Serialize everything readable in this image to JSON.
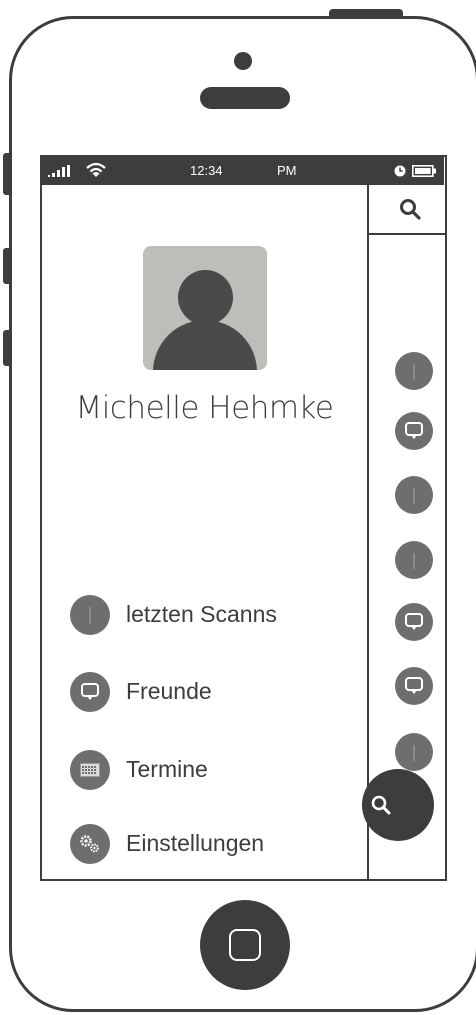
{
  "status_bar": {
    "time": "12:34",
    "ampm": "PM"
  },
  "profile": {
    "name": "Michelle Hehmke"
  },
  "menu": {
    "items": [
      {
        "label": "letzten Scanns",
        "icon": "info-icon"
      },
      {
        "label": "Freunde",
        "icon": "chat-bubble-icon"
      },
      {
        "label": "Termine",
        "icon": "calendar-icon"
      },
      {
        "label": "Einstellungen",
        "icon": "gears-icon"
      }
    ]
  },
  "rail": {
    "icons": [
      "info-icon",
      "chat-bubble-icon",
      "info-icon",
      "info-icon",
      "chat-bubble-icon",
      "chat-bubble-icon",
      "info-icon",
      "chat-bubble-icon"
    ]
  },
  "colors": {
    "frame": "#3d3d3d",
    "icon_bg": "#6e6e6e",
    "avatar_bg": "#bfbdba",
    "background": "#ffffff"
  }
}
